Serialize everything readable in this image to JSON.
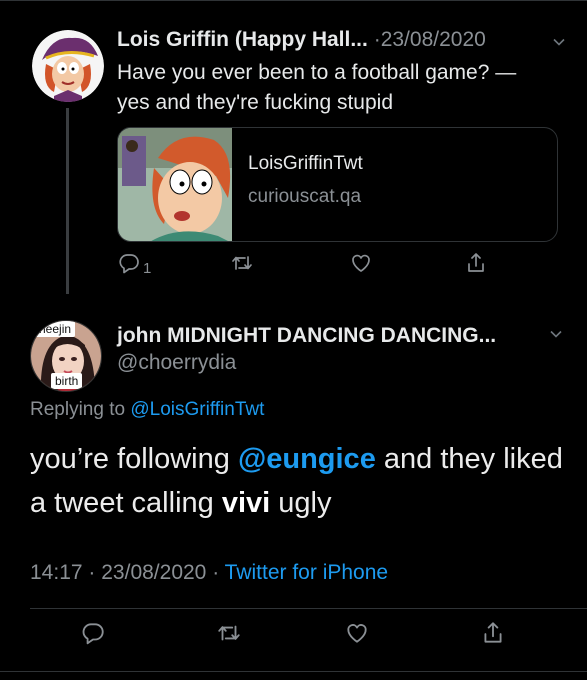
{
  "parent_tweet": {
    "display_name": "Lois Griffin (Happy Hall...",
    "separator": "·",
    "date": "23/08/2020",
    "text_lines": [
      "Have you ever been to a football game? —",
      "yes and they're fucking stupid"
    ],
    "link_card": {
      "title": "LoisGriffinTwt",
      "domain": "curiouscat.qa"
    },
    "actions": {
      "reply_count": "1"
    }
  },
  "reply_tweet": {
    "display_name": "john MIDNIGHT DANCING DANCING...",
    "handle": "@choerrydia",
    "avatar_tags": [
      "heejin",
      "birth"
    ],
    "replying_to_prefix": "Replying to",
    "replying_to_handle": "@LoisGriffinTwt",
    "body": {
      "part1": "you’re following ",
      "mention": "@eungice",
      "part2": " and they liked a tweet calling ",
      "bold": "vivi",
      "part3": " ugly"
    },
    "time": "14:17",
    "dot1": "·",
    "date": "23/08/2020",
    "dot2": "·",
    "source": "Twitter for iPhone"
  },
  "colors": {
    "background": "#000000",
    "link_blue": "#1d9bf0",
    "secondary_text": "#8b9095"
  },
  "icons": [
    "reply-icon",
    "retweet-icon",
    "like-icon",
    "share-icon",
    "chevron-down-icon"
  ]
}
